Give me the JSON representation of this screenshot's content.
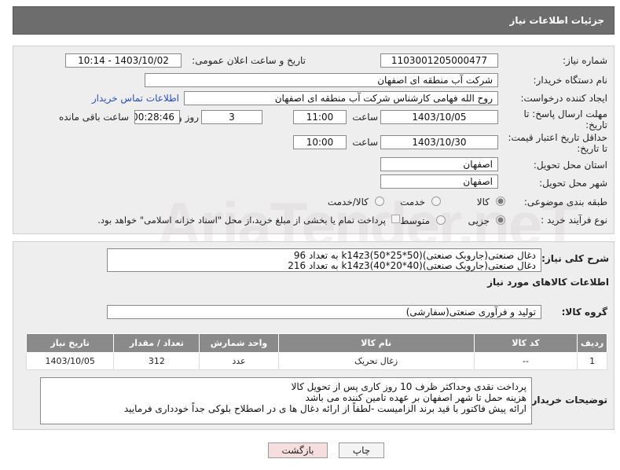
{
  "header": {
    "title": "جزئیات اطلاعات نیاز"
  },
  "form": {
    "need_number_label": "شماره نیاز:",
    "need_number": "1103001205000477",
    "announce_label": "تاریخ و ساعت اعلان عمومی:",
    "announce_value": "1403/10/02 - 10:14",
    "buyer_org_label": "نام دستگاه خریدار:",
    "buyer_org": "شرکت آب منطقه ای اصفهان",
    "requester_label": "ایجاد کننده درخواست:",
    "requester": "روح الله فهامی کارشناس شرکت آب منطقه ای اصفهان",
    "contact_link": "اطلاعات تماس خریدار",
    "deadline_label": "مهلت ارسال پاسخ: تا تاریخ:",
    "deadline_date": "1403/10/05",
    "time_label": "ساعت",
    "deadline_time": "11:00",
    "days_value": "3",
    "days_label": "روز و",
    "remaining_value": "00:28:46",
    "remaining_label": "ساعت باقی مانده",
    "validity_label": "حداقل تاریخ اعتبار قیمت: تا تاریخ:",
    "validity_date": "1403/10/30",
    "validity_time": "10:00",
    "province_label": "استان محل تحویل:",
    "province": "اصفهان",
    "city_label": "شهر محل تحویل:",
    "city": "اصفهان",
    "category_label": "طبقه بندی موضوعی:",
    "category_options": [
      "کالا",
      "خدمت",
      "کالا/خدمت"
    ],
    "process_label": "نوع فرآیند خرید :",
    "process_options": [
      "جزیی",
      "متوسط"
    ],
    "payment_note": "پرداخت تمام یا بخشی از مبلغ خرید،از محل \"اسناد خزانه اسلامی\" خواهد بود."
  },
  "description": {
    "label": "شرح کلی نیاز:",
    "line1": "دغال صنعتی(جاروبک صنعتی)(50*25*50)k14z3 به تعداد 96",
    "line2": "دغال صنعتی(جاروبک صنعتی)(40*20*40)k14z3 به تعداد 216"
  },
  "goods": {
    "section_title": "اطلاعات کالاهای مورد نیاز",
    "group_label": "گروه کالا:",
    "group_value": "تولید و فرآوری صنعتی(سفارشی)",
    "columns": [
      "ردیف",
      "کد کالا",
      "نام کالا",
      "واحد شمارش",
      "تعداد / مقدار",
      "تاریخ نیاز"
    ],
    "rows": [
      [
        "1",
        "--",
        "زغال تحریک",
        "عدد",
        "312",
        "1403/10/05"
      ]
    ]
  },
  "buyer_notes": {
    "label": "توضیحات خریدار:",
    "line1": "پرداخت نقدی وحداکثر ظرف 10 روز کاری پس از تحویل کالا",
    "line2": "هزینه حمل تا شهر اصفهان بر عهده تامین کننده می باشد",
    "line3": "ارائه پیش فاکتور با قید برند الزامیست -لطفاً از ارائه دغال ها ی در اصطلاح بلوکی جداً خودداری فرمایید"
  },
  "buttons": {
    "print": "چاپ",
    "back": "بازگشت"
  },
  "watermark": "AriaTender.neT",
  "colors": {
    "header_bg": "#6d6d6d",
    "panel_bg": "#eeeeee",
    "link": "#2a4fb4",
    "back_btn": "#f7dede"
  }
}
